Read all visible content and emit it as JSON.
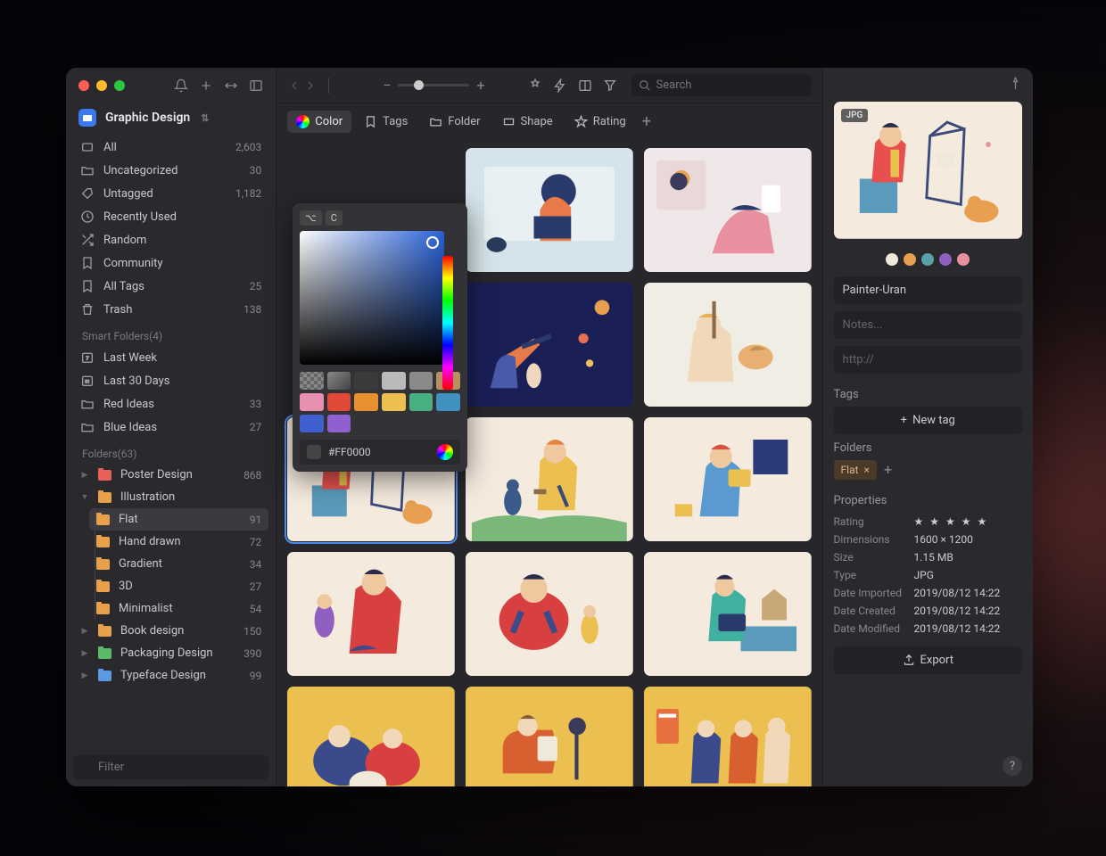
{
  "library": {
    "name": "Graphic Design"
  },
  "sidebar": {
    "items": [
      {
        "label": "All",
        "count": "2,603",
        "icon": "all"
      },
      {
        "label": "Uncategorized",
        "count": "30",
        "icon": "uncat"
      },
      {
        "label": "Untagged",
        "count": "1,182",
        "icon": "untag"
      },
      {
        "label": "Recently Used",
        "count": "",
        "icon": "clock"
      },
      {
        "label": "Random",
        "count": "",
        "icon": "random"
      },
      {
        "label": "Community",
        "count": "",
        "icon": "community"
      },
      {
        "label": "All Tags",
        "count": "25",
        "icon": "tag"
      },
      {
        "label": "Trash",
        "count": "138",
        "icon": "trash"
      }
    ],
    "smart_header": "Smart Folders(4)",
    "smart": [
      {
        "label": "Last Week",
        "icon": "cal7"
      },
      {
        "label": "Last 30 Days",
        "icon": "cal30"
      },
      {
        "label": "Red Ideas",
        "count": "33",
        "icon": "sfolder"
      },
      {
        "label": "Blue Ideas",
        "count": "27",
        "icon": "sfolder"
      }
    ],
    "folders_header": "Folders(63)",
    "folders": [
      {
        "label": "Poster Design",
        "count": "868",
        "color": "f-red",
        "disclosure": "▶"
      },
      {
        "label": "Illustration",
        "count": "",
        "color": "f-orange",
        "disclosure": "▼",
        "expanded": true
      },
      {
        "label": "Book design",
        "count": "150",
        "color": "f-orange",
        "disclosure": "▶"
      },
      {
        "label": "Packaging Design",
        "count": "390",
        "color": "f-green",
        "disclosure": "▶"
      },
      {
        "label": "Typeface Design",
        "count": "99",
        "color": "f-blue",
        "disclosure": "▶"
      }
    ],
    "subfolders": [
      {
        "label": "Flat",
        "count": "91",
        "selected": true
      },
      {
        "label": "Hand drawn",
        "count": "72"
      },
      {
        "label": "Gradient",
        "count": "34"
      },
      {
        "label": "3D",
        "count": "27"
      },
      {
        "label": "Minimalist",
        "count": "54"
      }
    ],
    "filter_placeholder": "Filter"
  },
  "toolbar": {
    "search_placeholder": "Search"
  },
  "filterbar": {
    "items": [
      {
        "label": "Color",
        "active": true
      },
      {
        "label": "Tags"
      },
      {
        "label": "Folder"
      },
      {
        "label": "Shape"
      },
      {
        "label": "Rating"
      }
    ]
  },
  "color_picker": {
    "key_hint1": "⌥",
    "key_hint2": "C",
    "hex": "#FF0000",
    "swatches": [
      "#777",
      "#555",
      "#333",
      "#bbb",
      "#999",
      "#b88",
      "#d9a",
      "#e55",
      "#e90",
      "#ec5",
      "#4b8",
      "#49c",
      "#46d",
      "#96d"
    ]
  },
  "inspector": {
    "badge": "JPG",
    "name": "Painter-Uran",
    "notes_placeholder": "Notes...",
    "url_placeholder": "http://",
    "tags_label": "Tags",
    "new_tag": "New tag",
    "folders_label": "Folders",
    "folder_chip": "Flat",
    "properties_label": "Properties",
    "properties": [
      {
        "k": "Rating",
        "v": "★ ★ ★ ★ ★"
      },
      {
        "k": "Dimensions",
        "v": "1600 × 1200"
      },
      {
        "k": "Size",
        "v": "1.15 MB"
      },
      {
        "k": "Type",
        "v": "JPG"
      },
      {
        "k": "Date Imported",
        "v": "2019/08/12 14:22"
      },
      {
        "k": "Date Created",
        "v": "2019/08/12 14:22"
      },
      {
        "k": "Date Modified",
        "v": "2019/08/12 14:22"
      }
    ],
    "export": "Export",
    "dots": [
      "#f0e8d8",
      "#e8a050",
      "#5aa0a8",
      "#9060c0",
      "#e890a0"
    ]
  }
}
